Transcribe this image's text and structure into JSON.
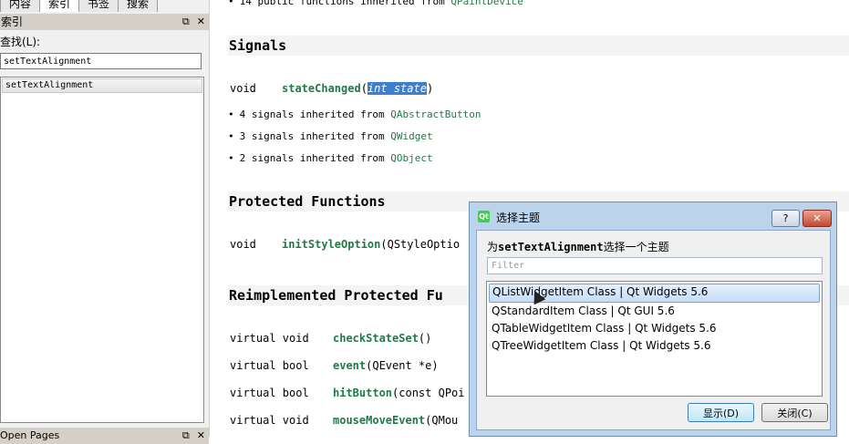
{
  "left_panel": {
    "tabs": [
      "内容",
      "索引",
      "书签",
      "搜索"
    ],
    "active_tab": 1,
    "dock_title": "索引",
    "find_label": "查找(L):",
    "find_value": "setTextAlignment",
    "index_items": [
      "setTextAlignment"
    ],
    "bottom_dock_title": "Open Pages"
  },
  "doc": {
    "top_inherited": {
      "text": "14 public functions inherited from ",
      "link": "QPaintDevice"
    },
    "signals_heading": "Signals",
    "signal": {
      "ret": "void",
      "name": "stateChanged",
      "open": "(",
      "param": "int state",
      "close": ")"
    },
    "signals_inherited": [
      {
        "text": "4 signals inherited from ",
        "link": "QAbstractButton"
      },
      {
        "text": "3 signals inherited from ",
        "link": "QWidget"
      },
      {
        "text": "2 signals inherited from ",
        "link": "QObject"
      }
    ],
    "protected_heading": "Protected Functions",
    "protected_fn": {
      "ret": "void",
      "name": "initStyleOption",
      "args": "(QStyleOptio"
    },
    "reimpl_heading": "Reimplemented Protected Fu",
    "reimpl_rows": [
      {
        "ret": "virtual void",
        "name": "checkStateSet",
        "args": "()"
      },
      {
        "ret": "virtual bool",
        "name": "event",
        "args": "(QEvent *e)"
      },
      {
        "ret": "virtual bool",
        "name": "hitButton",
        "args": "(const QPoi"
      },
      {
        "ret": "virtual void",
        "name": "mouseMoveEvent",
        "args": "(QMou"
      }
    ]
  },
  "dialog": {
    "title": "选择主题",
    "help_label": "?",
    "close_label": "✕",
    "prompt_prefix": "为",
    "prompt_keyword": "setTextAlignment",
    "prompt_suffix": "选择一个主题",
    "filter_placeholder": "Filter",
    "items": [
      "QListWidgetItem Class | Qt Widgets 5.6",
      "QStandardItem Class | Qt GUI 5.6",
      "QTableWidgetItem Class | Qt Widgets 5.6",
      "QTreeWidgetItem Class | Qt Widgets 5.6"
    ],
    "selected_index": 0,
    "show_button": "显示(D)",
    "close_button": "关闭(C)"
  },
  "icons": {
    "dock_float": "float-icon",
    "dock_close": "close-icon",
    "app_logo": "qt-logo-icon",
    "bullet": "bullet-icon"
  }
}
